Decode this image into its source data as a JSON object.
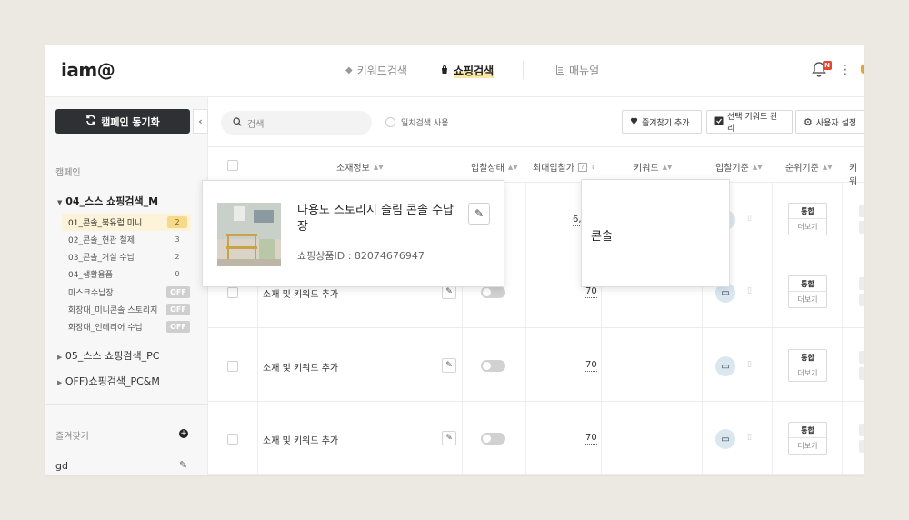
{
  "app": {
    "logo": "iam@",
    "nav": [
      {
        "label": "키워드검색",
        "icon": "tag-icon",
        "active": false
      },
      {
        "label": "쇼핑검색",
        "icon": "shopping-bag-icon",
        "active": true
      },
      {
        "label": "매뉴얼",
        "icon": "document-icon",
        "active": false
      }
    ],
    "notification_badge": "N",
    "accent": "#f6d98a"
  },
  "sidebar": {
    "sync_label": "캠페인 동기화",
    "collapse_icon": "‹",
    "section_campaign": "캠페인",
    "groups": [
      {
        "label": "04_스스 쇼핑검색_M",
        "open": true
      },
      {
        "label": "05_스스 쇼핑검색_PC",
        "open": false
      },
      {
        "label": "OFF)쇼핑검색_PC&M",
        "open": false
      }
    ],
    "items": [
      {
        "label": "01_콘솔_북유럽 미니",
        "count": "2",
        "selected": true
      },
      {
        "label": "02_콘솔_현관 철제",
        "count": "3"
      },
      {
        "label": "03_콘솔_거실 수납",
        "count": "2"
      },
      {
        "label": "04_생활용품",
        "count": "0"
      },
      {
        "label": "마스크수납장",
        "status": "OFF"
      },
      {
        "label": "화장대_미니콘솔 스토리지",
        "status": "OFF"
      },
      {
        "label": "화장대_인테리어 수납",
        "status": "OFF"
      }
    ],
    "favorites_label": "즐겨찾기",
    "favorite_item": "gd"
  },
  "toolbar": {
    "search_placeholder": "검색",
    "exact_match": "일치검색 사용",
    "add_favorite": "즐겨찾기 추가",
    "manage_keyword": "선택 키워드 관리",
    "user_settings": "사용자 설정"
  },
  "table": {
    "headers": {
      "info": "소재정보",
      "bid_status": "입찰상태",
      "max_bid": "최대입찰가",
      "keyword": "키워드",
      "bid_basis": "입찰기준",
      "rank_basis": "순위기준",
      "keyword2": "키워"
    },
    "rows": [
      {
        "text": "소재 및 키워드 추가",
        "bid": "70",
        "rank": "통합",
        "more": "더보기"
      },
      {
        "text": "소재 및 키워드 추가",
        "bid": "70",
        "rank": "통합",
        "more": "더보기"
      },
      {
        "text": "소재 및 키워드 추가",
        "bid": "70",
        "rank": "통합",
        "more": "더보기"
      }
    ],
    "first_row_partial": {
      "bid": "6,",
      "rank": "통합",
      "more": "더보기"
    }
  },
  "product_popup": {
    "name": "다용도 스토리지 슬림 콘솔 수납장",
    "id_line": "쇼핑상품ID : 82074676947"
  },
  "keyword_popup": {
    "text": "콘솔"
  }
}
